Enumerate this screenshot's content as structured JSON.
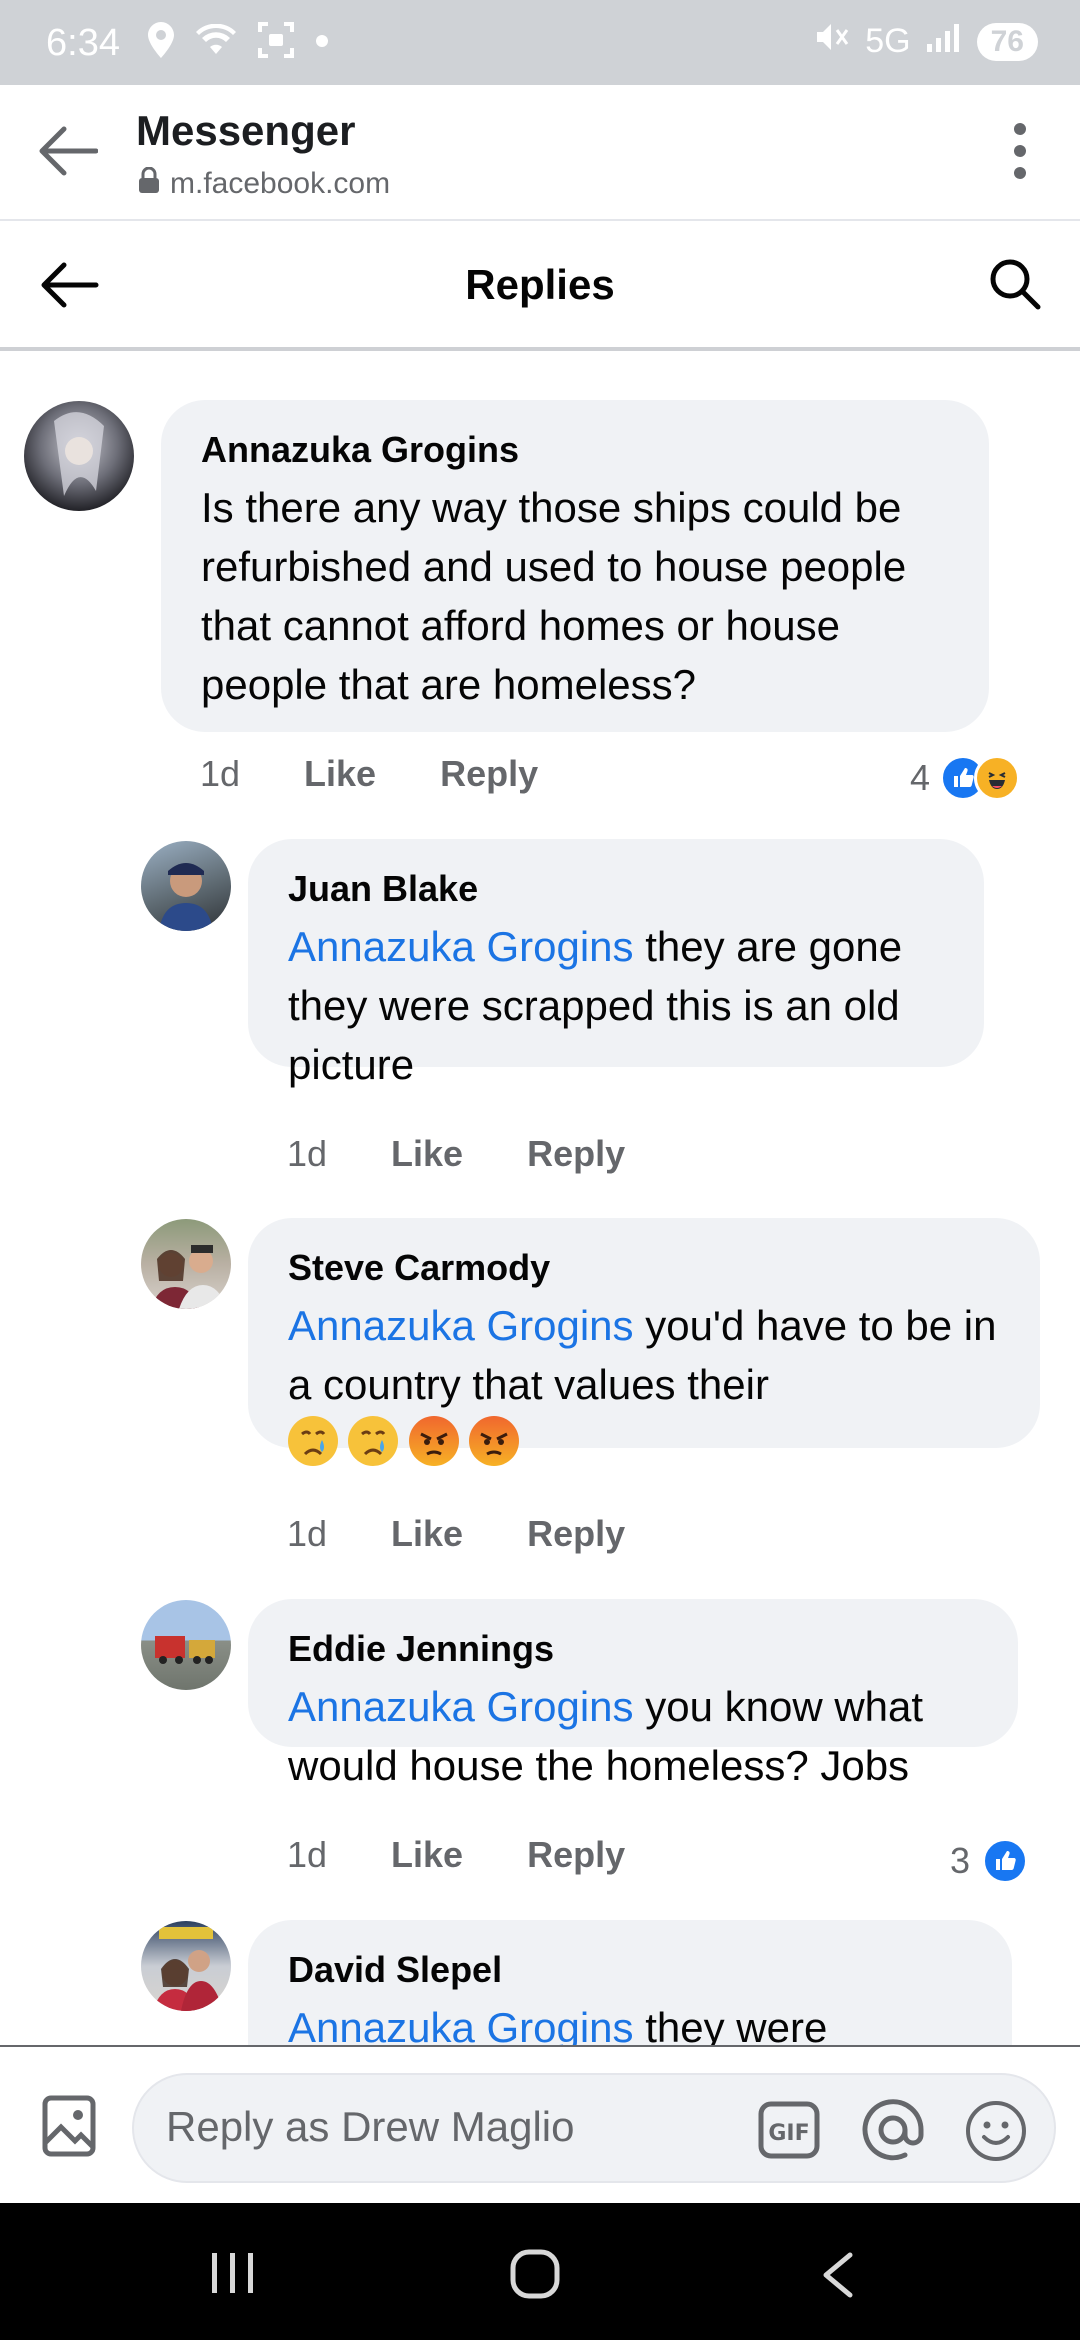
{
  "status_bar": {
    "time": "6:34",
    "network": "5G",
    "battery": "76"
  },
  "browser": {
    "title": "Messenger",
    "url": "m.facebook.com"
  },
  "header": {
    "title": "Replies"
  },
  "comments": [
    {
      "author": "Annazuka Grogins",
      "mention": "",
      "text": "Is there any way those ships could be refurbished and used to house people that cannot afford homes or house people that are homeless?",
      "time": "1d",
      "like_label": "Like",
      "reply_label": "Reply",
      "reaction_count": "4"
    },
    {
      "author": "Juan Blake",
      "mention": "Annazuka Grogins",
      "text": " they are gone they were scrapped this is an old picture",
      "time": "1d",
      "like_label": "Like",
      "reply_label": "Reply"
    },
    {
      "author": "Steve Carmody",
      "mention": "Annazuka Grogins",
      "text": " you'd have to be in a country that values their",
      "time": "1d",
      "like_label": "Like",
      "reply_label": "Reply"
    },
    {
      "author": "Eddie Jennings",
      "mention": "Annazuka Grogins",
      "text": " you know what would house the homeless? Jobs",
      "time": "1d",
      "like_label": "Like",
      "reply_label": "Reply",
      "reaction_count": "3"
    },
    {
      "author": "David Slepel",
      "mention": "Annazuka Grogins",
      "text": " they were"
    }
  ],
  "composer": {
    "placeholder": "Reply as Drew Maglio"
  },
  "colors": {
    "mention": "#1b74e4",
    "bubble": "#f0f2f5",
    "like_blue": "#1877f2"
  }
}
